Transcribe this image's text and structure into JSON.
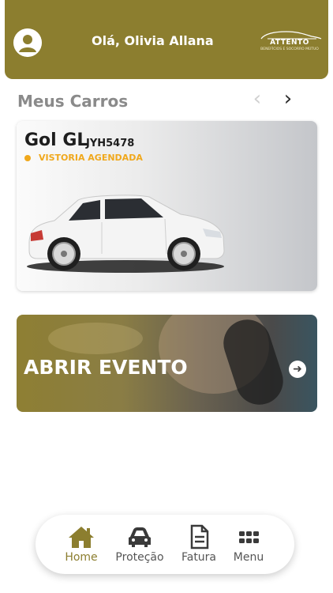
{
  "header": {
    "greeting": "Olá, Olivia Allana",
    "logo_text": "ATTENTO",
    "logo_subtitle": "BENEFÍCIOS E SOCORRO MÚTUO"
  },
  "my_cars": {
    "title": "Meus Carros",
    "car": {
      "name": "Gol GL",
      "plate": "JYH5478",
      "status": "VISTORIA AGENDADA",
      "status_color": "#f0a81c"
    }
  },
  "event_banner": {
    "title": "ABRIR EVENTO"
  },
  "bottom_nav": {
    "items": [
      {
        "label": "Home",
        "icon": "home-icon",
        "active": true
      },
      {
        "label": "Proteção",
        "icon": "car-icon",
        "active": false
      },
      {
        "label": "Fatura",
        "icon": "document-icon",
        "active": false
      },
      {
        "label": "Menu",
        "icon": "grid-icon",
        "active": false
      }
    ]
  },
  "colors": {
    "brand": "#8c7e2f",
    "status": "#f0a81c",
    "section_title": "#8a8a8a"
  }
}
